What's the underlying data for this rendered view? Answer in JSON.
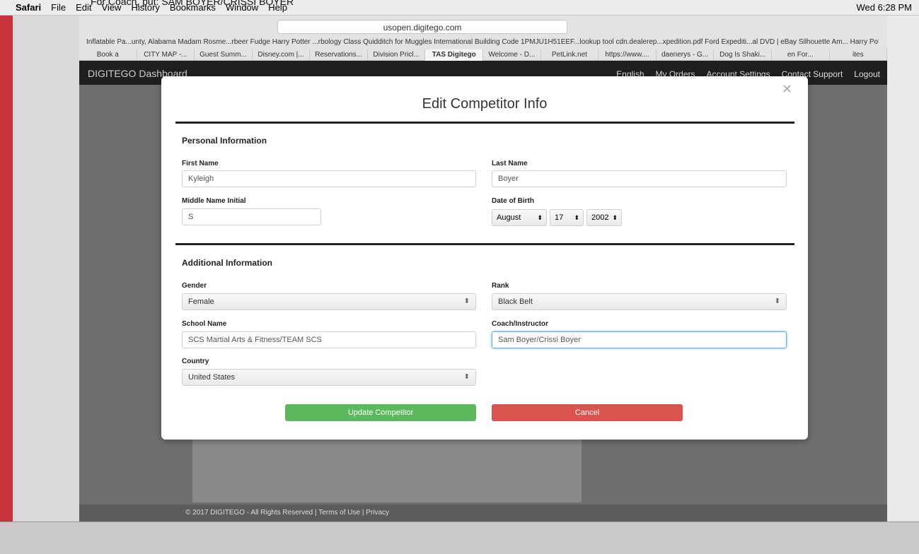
{
  "menubar": {
    "apple": "",
    "app": "Safari",
    "items": [
      "File",
      "Edit",
      "View",
      "History",
      "Bookmarks",
      "Window",
      "Help"
    ],
    "clock": "Wed 6:28 PM"
  },
  "tooltip": "For Coach, put: SAM BOYER/CRISSI BOYER",
  "browser": {
    "url": "usopen.digitego.com",
    "bookmarks": "Inflatable Pa...unty, Alabama   Madam Rosme...rbeer Fudge   Harry Potter ...rbology Class   Quidditch for Muggles   International Building Code   1PMJU1H51EEF...lookup tool   cdn.dealerep...xpedition.pdf   Ford Expediti...al DVD | eBay   Silhouette Am... Harry Potter",
    "tabs": [
      "Book a",
      "CITY MAP -...",
      "Guest Summ...",
      "Disney.com |...",
      "Reservations...",
      "Division Pricl...",
      "TAS Digitego",
      "Welcome - D...",
      "PetLink.net",
      "https://www....",
      "daenerys - G...",
      "Dog Is Shaki...",
      "en For...",
      "ites"
    ]
  },
  "dashboard": {
    "brand": "DIGITEGO Dashboard",
    "language": "English",
    "links": [
      "My Orders",
      "Account Settings",
      "Contact Support",
      "Logout"
    ],
    "footer": "© 2017 DIGITEGO - All Rights Reserved | Terms of Use | Privacy"
  },
  "modal": {
    "title": "Edit Competitor Info",
    "personal_header": "Personal Information",
    "first_name_label": "First Name",
    "first_name": "Kyleigh",
    "last_name_label": "Last Name",
    "last_name": "Boyer",
    "mi_label": "Middle Name Initial",
    "mi": "S",
    "dob_label": "Date of Birth",
    "dob_month": "August",
    "dob_day": "17",
    "dob_year": "2002",
    "additional_header": "Additional Information",
    "gender_label": "Gender",
    "gender": "Female",
    "rank_label": "Rank",
    "rank": "Black Belt",
    "school_label": "School Name",
    "school": "SCS Martial Arts & Fitness/TEAM SCS",
    "coach_label": "Coach/Instructor",
    "coach": "Sam Boyer/Crissi Boyer",
    "country_label": "Country",
    "country": "United States",
    "update_label": "Update Competitor",
    "cancel_label": "Cancel"
  }
}
